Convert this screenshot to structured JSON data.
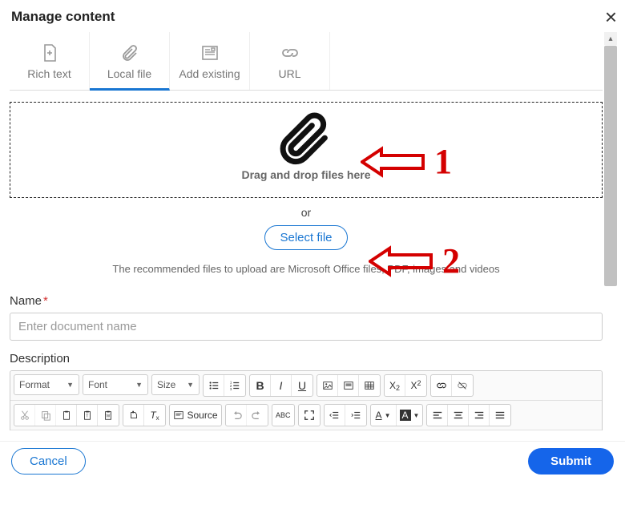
{
  "dialog": {
    "title": "Manage content"
  },
  "tabs": {
    "rich_text": "Rich text",
    "local_file": "Local file",
    "add_existing": "Add existing",
    "url": "URL"
  },
  "dropzone": {
    "text": "Drag and drop files here"
  },
  "or_label": "or",
  "select_file_label": "Select file",
  "hint": "The recommended files to upload are Microsoft Office files, PDF, images and videos",
  "name_field": {
    "label": "Name",
    "placeholder": "Enter document name",
    "value": ""
  },
  "description_label": "Description",
  "editor": {
    "format_label": "Format",
    "font_label": "Font",
    "size_label": "Size",
    "source_label": "Source",
    "text_color_letter": "A",
    "bg_color_letter": "A"
  },
  "callouts": {
    "one": "1",
    "two": "2"
  },
  "footer": {
    "cancel": "Cancel",
    "submit": "Submit"
  }
}
